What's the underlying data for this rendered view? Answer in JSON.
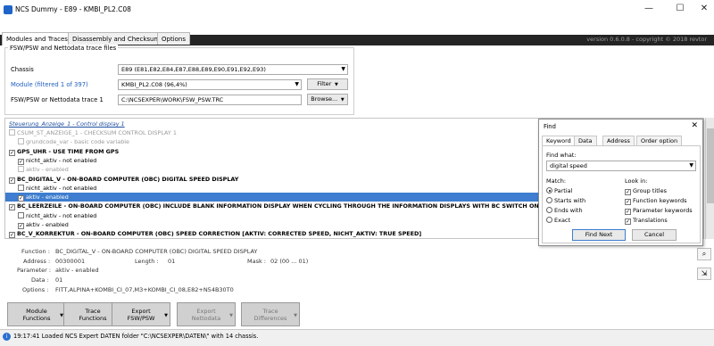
{
  "window": {
    "title": "NCS Dummy - E89 - KMBI_PL2.C08",
    "min": "—",
    "max": "☐",
    "close": "✕"
  },
  "tabs": [
    "Modules and Traces",
    "Disassembly and Checksums",
    "Options"
  ],
  "version": "version 0.6.0.8 - copyright © 2018 revtor",
  "group": {
    "legend": "FSW/PSW and Nettodata trace files",
    "chassis_label": "Chassis",
    "chassis_value": "E89  (E81,E82,E84,E87,E88,E89,E90,E91,E92,E93)",
    "module_label": "Module (filtered 1 of 397)",
    "module_value": "KMBI_PL2.C08  (96,4%)",
    "filter_btn": "Filter",
    "trace_label": "FSW/PSW or Nettodata trace 1",
    "trace_value": "C:\\NCSEXPER\\WORK\\FSW_PSW.TRC",
    "browse_btn": "Browse..."
  },
  "list": {
    "header": "Steuerung_Anzeige_1  -  Control display 1",
    "rows": [
      {
        "text": "CSUM_ST_ANZEIGE_1  -  CHECKSUM CONTROL DISPLAY 1",
        "check": "",
        "style": "grey"
      },
      {
        "text": "grundcode_var  -  basic code variable",
        "check": "",
        "style": "grey-sub"
      },
      {
        "text": "GPS_UHR  -  USE TIME FROM GPS",
        "check": "✓",
        "style": "bold"
      },
      {
        "text": "nicht_aktiv  -  not enabled",
        "check": "✓",
        "style": "sub"
      },
      {
        "text": "aktiv  -  enabled",
        "check": "",
        "style": "grey-sub"
      },
      {
        "text": "BC_DIGITAL_V  -  ON-BOARD COMPUTER (OBC) DIGITAL SPEED DISPLAY",
        "check": "✓",
        "style": "bold"
      },
      {
        "text": "nicht_aktiv  -  not enabled",
        "check": "",
        "style": "sub"
      },
      {
        "text": "aktiv  -  enabled",
        "check": "✓",
        "style": "sel"
      },
      {
        "text": "BC_LEERZEILE  -  ON-BOARD COMPUTER (OBC) INCLUDE BLANK INFORMATION DISPLAY WHEN CYCLING THROUGH THE INFORMATION DISPLAYS WITH BC SWITCH ON TURN SI",
        "check": "✓",
        "style": "bold"
      },
      {
        "text": "nicht_aktiv  -  not enabled",
        "check": "",
        "style": "sub"
      },
      {
        "text": "aktiv  -  enabled",
        "check": "✓",
        "style": "sub"
      },
      {
        "text": "BC_V_KORREKTUR  -  ON-BOARD COMPUTER (OBC) SPEED CORRECTION [AKTIV: CORRECTED SPEED, NICHT_AKTIV: TRUE SPEED]",
        "check": "✓",
        "style": "bold"
      }
    ]
  },
  "details": {
    "function_label": "Function :",
    "function_value": "BC_DIGITAL_V  -  ON-BOARD COMPUTER (OBC) DIGITAL SPEED DISPLAY",
    "address_label": "Address :",
    "address_value": "00300001",
    "length_label": "Length :",
    "length_value": "01",
    "mask_label": "Mask :",
    "mask_value": "02  (00 ... 01)",
    "parameter_label": "Parameter :",
    "parameter_value": "aktiv  -  enabled",
    "data_label": "Data :",
    "data_value": "01",
    "options_label": "Options :",
    "options_value": "FITT,ALPINA+KOMBI_CI_07,M3+KOMBI_CI_08,E82+N54B30T0"
  },
  "buttons": [
    {
      "l1": "Module",
      "l2": "Functions",
      "dd": "▼",
      "disabled": false
    },
    {
      "l1": "Trace",
      "l2": "Functions",
      "dd": "▼",
      "disabled": false
    },
    {
      "l1": "Export",
      "l2": "FSW/PSW",
      "dd": "▼",
      "disabled": false
    },
    {
      "l1": "Export",
      "l2": "Nettodata",
      "dd": "▼",
      "disabled": true
    },
    {
      "l1": "Trace",
      "l2": "Differences",
      "dd": "▼",
      "disabled": true
    }
  ],
  "status": {
    "icon": "i",
    "message": "19:17:41  Loaded NCS Expert DATEN folder \"C:\\NCSEXPER\\DATEN\\\" with 14 chassis."
  },
  "find": {
    "title": "Find",
    "close": "✕",
    "tabs": [
      "Keyword",
      "Data",
      "Address",
      "Order option"
    ],
    "find_what_label": "Find what:",
    "find_what_value": "digital speed",
    "match_label": "Match:",
    "match_options": [
      {
        "label": "Partial",
        "on": true
      },
      {
        "label": "Starts with",
        "on": false
      },
      {
        "label": "Ends with",
        "on": false
      },
      {
        "label": "Exact",
        "on": false
      }
    ],
    "lookin_label": "Look in:",
    "lookin_options": [
      {
        "label": "Group titles",
        "on": true
      },
      {
        "label": "Function keywords",
        "on": true
      },
      {
        "label": "Parameter keywords",
        "on": true
      },
      {
        "label": "Translations",
        "on": true
      }
    ],
    "find_next": "Find Next",
    "cancel": "Cancel"
  }
}
